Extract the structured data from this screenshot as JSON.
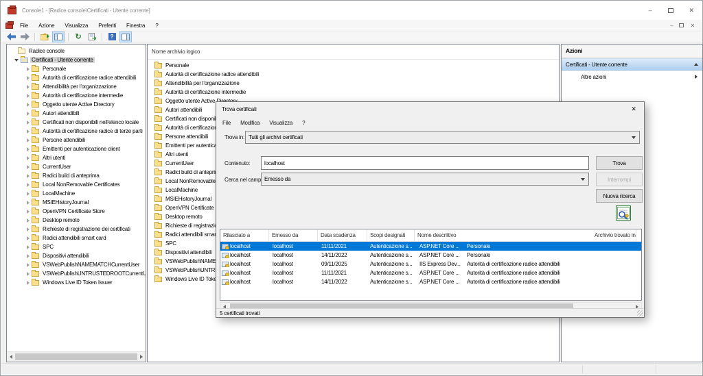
{
  "colors": {
    "selection": "#0078d7",
    "action_bar_blue": "#aecfee",
    "folder_yellow": "#fbdf8c",
    "titlebar_text": "#8a8a8a"
  },
  "icons": {
    "close": "✕",
    "minimize": "–",
    "help_glyph": "?",
    "refresh_glyph": "↻"
  },
  "window": {
    "title": "Console1 - [Radice console\\Certificati - Utente corrente]",
    "menu": [
      "File",
      "Azione",
      "Visualizza",
      "Preferiti",
      "Finestra",
      "?"
    ],
    "toolbar_icons": [
      "back-icon",
      "forward-icon",
      "export-folder-icon",
      "show-console-tree-icon",
      "refresh-icon",
      "export-list-icon",
      "help-icon",
      "action-pane-icon"
    ]
  },
  "tree": {
    "root_label": "Radice console",
    "selected_label": "Certificati - Utente corrente",
    "children": [
      "Personale",
      "Autorità di certificazione radice attendibili",
      "Attendibilità per l'organizzazione",
      "Autorità di certificazione intermedie",
      "Oggetto utente Active Directory",
      "Autori attendibili",
      "Certificati non disponibili nell'elenco locale",
      "Autorità di certificazione radice di terze parti",
      "Persone attendibili",
      "Emittenti per autenticazione client",
      "Altri utenti",
      "CurrentUser",
      "Radici build di anteprima",
      "Local NonRemovable Certificates",
      "LocalMachine",
      "MSIEHistoryJournal",
      "OpenVPN Certificate Store",
      "Desktop remoto",
      "Richieste di registrazione dei certificati",
      "Radici attendibili smart card",
      "SPC",
      "Dispositivi attendibili",
      "VSWebPublishNAMEMATCHCurrentUser",
      "VSWebPublishUNTRUSTEDROOTCurrentUser",
      "Windows Live ID Token Issuer"
    ]
  },
  "list": {
    "header": "Nome archivio logico",
    "items": [
      "Personale",
      "Autorità di certificazione radice attendibili",
      "Attendibilità per l'organizzazione",
      "Autorità di certificazione intermedie",
      "Oggetto utente Active Directory",
      "Autori attendibili",
      "Certificati non disponibili nell'elenco locale",
      "Autorità di certificazione radice di terze parti",
      "Persone attendibili",
      "Emittenti per autenticazione client",
      "Altri utenti",
      "CurrentUser",
      "Radici build di anteprima",
      "Local NonRemovable Certificates",
      "LocalMachine",
      "MSIEHistoryJournal",
      "OpenVPN Certificate Store",
      "Desktop remoto",
      "Richieste di registrazione dei certificati",
      "Radici attendibili smart card",
      "SPC",
      "Dispositivi attendibili",
      "VSWebPublishNAMEMATCHCurrentUser",
      "VSWebPublishUNTRUSTEDROOTCurrentUser",
      "Windows Live ID Token Issuer"
    ]
  },
  "actions": {
    "header": "Azioni",
    "section_title": "Certificati - Utente corrente",
    "more_label": "Altre azioni"
  },
  "dialog": {
    "title": "Trova certificati",
    "menu": [
      "File",
      "Modifica",
      "Visualizza",
      "?"
    ],
    "find_in_label": "Trova in:",
    "find_in_value": "Tutti gli archivi certificati",
    "content_label": "Contenuto:",
    "content_value": "localhost",
    "field_label": "Cerca nel campo:",
    "field_value": "Emesso da",
    "buttons": {
      "find": "Trova",
      "stop": "Interrompi",
      "new_search": "Nuova ricerca"
    },
    "table": {
      "columns": [
        "Rilasciato a",
        "Emesso da",
        "Data scadenza",
        "Scopi designati",
        "Nome descrittivo",
        "Archivio trovato in"
      ],
      "rows": [
        {
          "issued_to": "localhost",
          "issued_by": "localhost",
          "expiry": "11/11/2021",
          "purpose": "Autenticazione s...",
          "name": "ASP.NET Core ...",
          "store": "Personale",
          "selected": true
        },
        {
          "issued_to": "localhost",
          "issued_by": "localhost",
          "expiry": "14/11/2022",
          "purpose": "Autenticazione s...",
          "name": "ASP.NET Core ...",
          "store": "Personale"
        },
        {
          "issued_to": "localhost",
          "issued_by": "localhost",
          "expiry": "09/11/2025",
          "purpose": "Autenticazione s...",
          "name": "IIS Express Dev...",
          "store": "Autorità di certificazione radice attendibili"
        },
        {
          "issued_to": "localhost",
          "issued_by": "localhost",
          "expiry": "11/11/2021",
          "purpose": "Autenticazione s...",
          "name": "ASP.NET Core ...",
          "store": "Autorità di certificazione radice attendibili"
        },
        {
          "issued_to": "localhost",
          "issued_by": "localhost",
          "expiry": "14/11/2022",
          "purpose": "Autenticazione s...",
          "name": "ASP.NET Core ...",
          "store": "Autorità di certificazione radice attendibili"
        }
      ]
    },
    "status": "5 certificati trovati"
  }
}
